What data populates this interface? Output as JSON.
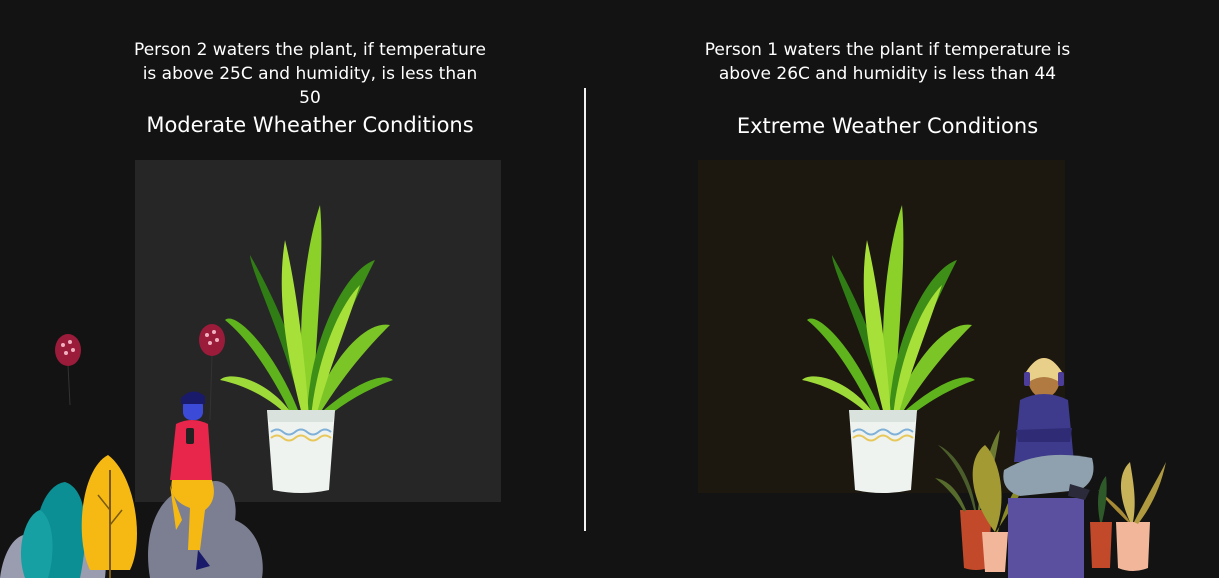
{
  "left": {
    "description": "Person 2 waters the plant, if temperature is above 25C and humidity, is less than 50",
    "title": "Moderate Wheather Conditions",
    "panel_color": "#262626"
  },
  "right": {
    "description": "Person 1 waters the plant if temperature is above 26C and humidity is less than 44",
    "title": "Extreme Weather Conditions",
    "panel_color": "#1c170f"
  },
  "icons": {
    "plant": "potted-plant-icon",
    "person_left": "person-with-phone-icon",
    "person_right": "person-sitting-headphones-icon",
    "balloon": "balloon-icon"
  },
  "colors": {
    "background": "#131313",
    "divider": "#f2f2f2",
    "leaf_light": "#8bd12a",
    "leaf_dark": "#2f7d14",
    "pot": "#f2f5f3"
  }
}
